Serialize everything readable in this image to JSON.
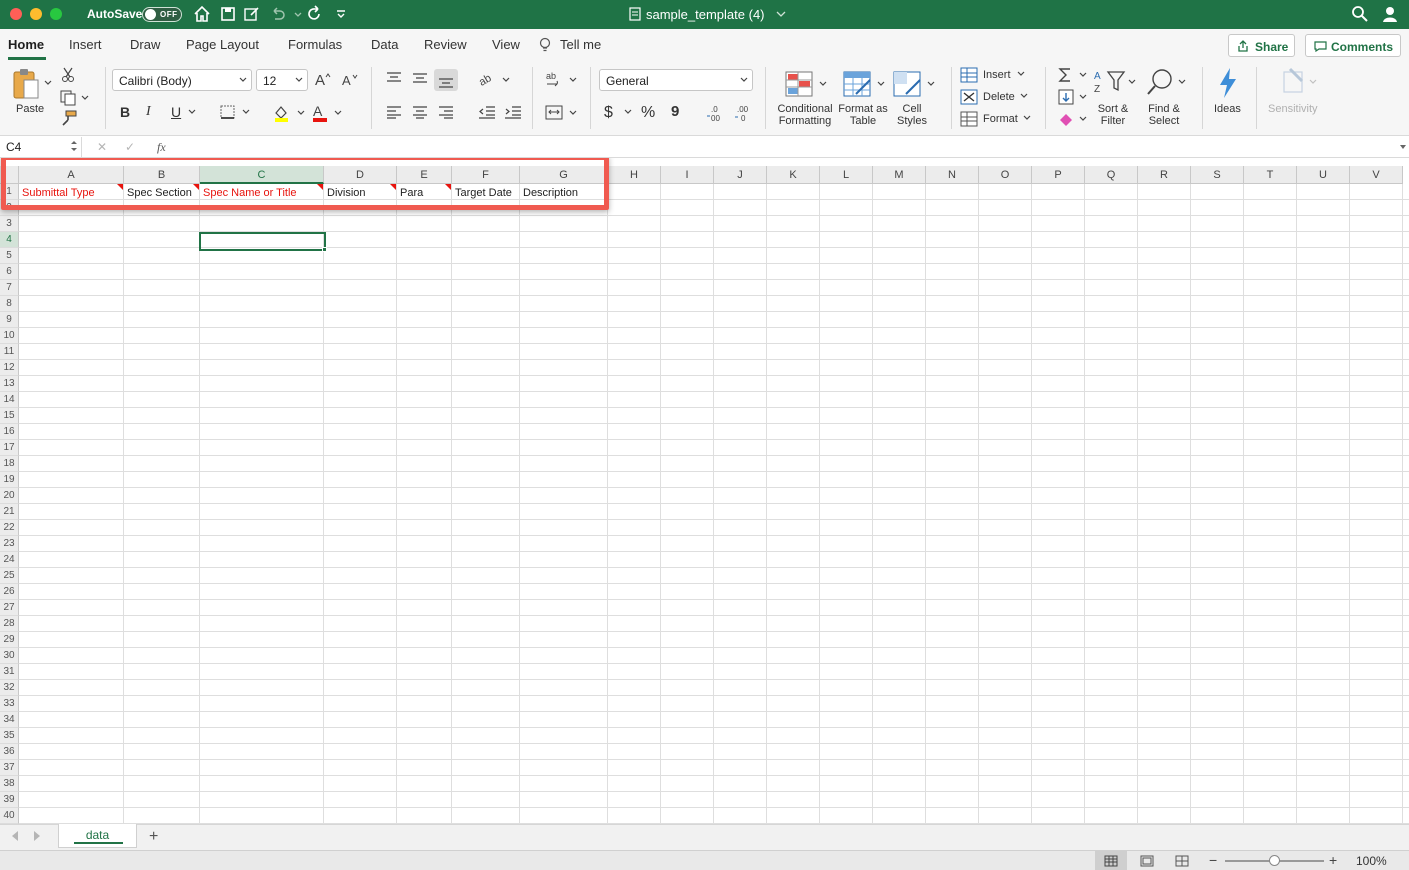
{
  "titlebar": {
    "autosave_label": "AutoSave",
    "autosave_state": "OFF",
    "document_title": "sample_template (4)"
  },
  "tabs": [
    {
      "label": "Home",
      "active": true
    },
    {
      "label": "Insert"
    },
    {
      "label": "Draw"
    },
    {
      "label": "Page Layout"
    },
    {
      "label": "Formulas"
    },
    {
      "label": "Data"
    },
    {
      "label": "Review"
    },
    {
      "label": "View"
    },
    {
      "label": "Tell me"
    }
  ],
  "header_actions": {
    "share": "Share",
    "comments": "Comments"
  },
  "ribbon": {
    "paste": "Paste",
    "font_name": "Calibri (Body)",
    "font_size": "12",
    "number_format": "General",
    "conditional_formatting": "Conditional Formatting",
    "format_as_table": "Format as Table",
    "cell_styles": "Cell Styles",
    "insert": "Insert",
    "delete": "Delete",
    "format": "Format",
    "sort_filter": "Sort & Filter",
    "find_select": "Find & Select",
    "ideas": "Ideas",
    "sensitivity": "Sensitivity",
    "bold": "B",
    "italic": "I",
    "underline": "U",
    "currency": "$",
    "percent": "%",
    "comma": "9",
    "fill_color": "#ffff00",
    "font_color": "#e8140e"
  },
  "formula_bar": {
    "name_box": "C4",
    "fx": "fx",
    "value": ""
  },
  "grid": {
    "columns": [
      "A",
      "B",
      "C",
      "D",
      "E",
      "F",
      "G",
      "H",
      "I",
      "J",
      "K",
      "L",
      "M",
      "N",
      "O",
      "P",
      "Q",
      "R",
      "S",
      "T",
      "U",
      "V"
    ],
    "selected_column": "C",
    "rows": [
      "1",
      "2",
      "3",
      "4",
      "5",
      "6",
      "7",
      "8",
      "9",
      "10",
      "11",
      "12",
      "13",
      "14",
      "15",
      "16",
      "17",
      "18",
      "19",
      "20",
      "21",
      "22",
      "23",
      "24",
      "25",
      "26",
      "27",
      "28",
      "29",
      "30",
      "31",
      "32",
      "33",
      "34",
      "35",
      "36",
      "37",
      "38",
      "39",
      "40"
    ],
    "selected_row": "4",
    "selected_cell": "C4",
    "header_cells": [
      {
        "col": "A",
        "text": "Submittal Type",
        "red": true,
        "note": true
      },
      {
        "col": "B",
        "text": "Spec Section",
        "red": false,
        "note": true
      },
      {
        "col": "C",
        "text": "Spec Name or Title",
        "red": true,
        "note": true
      },
      {
        "col": "D",
        "text": "Division",
        "red": false,
        "note": true
      },
      {
        "col": "E",
        "text": "Para",
        "red": false,
        "note": true
      },
      {
        "col": "F",
        "text": "Target Date",
        "red": false,
        "note": false
      },
      {
        "col": "G",
        "text": "Description",
        "red": false,
        "note": false
      }
    ],
    "highlight_color": "#f05a50"
  },
  "sheets": [
    {
      "label": "data",
      "active": true
    }
  ],
  "statusbar": {
    "zoom": "100%"
  }
}
